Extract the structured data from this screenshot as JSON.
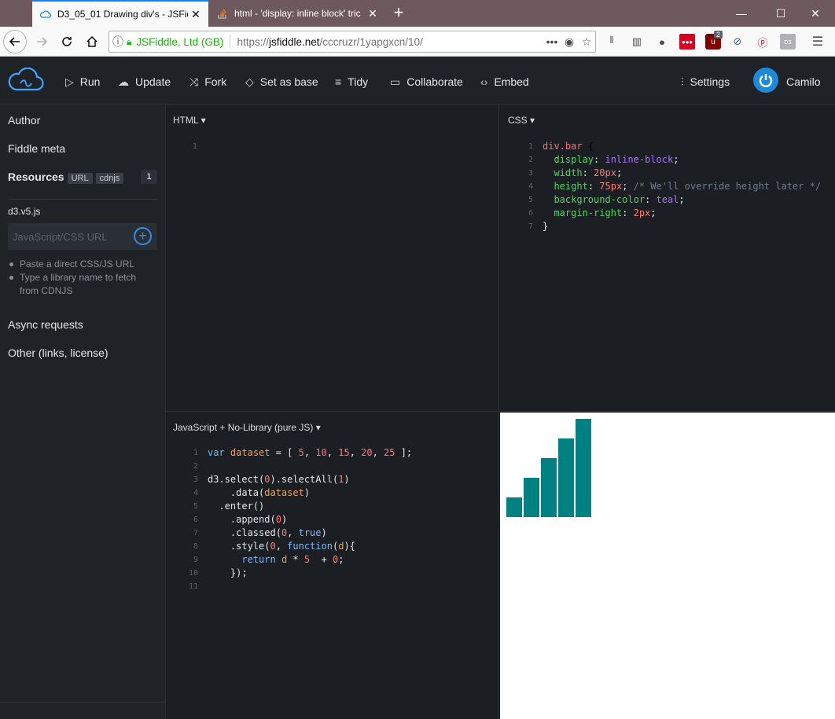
{
  "browser": {
    "tabs": [
      {
        "title": "D3_05_01 Drawing div's - JSFidd",
        "active": true
      },
      {
        "title": "html - 'display: inline block' tric",
        "active": false
      }
    ],
    "new_tab_label": "+",
    "site_identity": "JSFiddle, Ltd (GB)",
    "url_prefix": "https://",
    "url_domain": "jsfiddle.net",
    "url_path": "/cccruzr/1yapgxcn/10/",
    "badge_count": "2"
  },
  "toolbar": {
    "run": "Run",
    "update": "Update",
    "fork": "Fork",
    "set_as_base": "Set as base",
    "tidy": "Tidy",
    "collaborate": "Collaborate",
    "embed": "Embed",
    "settings": "Settings",
    "user": "Camilo"
  },
  "sidebar": {
    "author": "Author",
    "fiddle_meta": "Fiddle meta",
    "resources": "Resources",
    "chip_url": "URL",
    "chip_cdnjs": "cdnjs",
    "resource_count": "1",
    "resource_item": "d3.v5.js",
    "input_placeholder": "JavaScript/CSS URL",
    "hint1": "Paste a direct CSS/JS URL",
    "hint2_line1": "Type a library name to fetch",
    "hint2_line2": "from CDNJS",
    "async": "Async requests",
    "other": "Other (links, license)"
  },
  "panels": {
    "html_label": "HTML",
    "css_label": "CSS",
    "js_label": "JavaScript + No-Library (pure JS)"
  },
  "css_code": [
    "div.bar {",
    "  display: inline-block;",
    "  width: 20px;",
    "  height: 75px; /* We'll override height later */",
    "  background-color: teal;",
    "  margin-right: 2px;",
    "}"
  ],
  "js_code": [
    "var dataset = [ 5, 10, 15, 20, 25 ];",
    "",
    "d3.select(\"body\").selectAll(\"div\")",
    "    .data(dataset)",
    "  .enter()",
    "    .append(\"div\")",
    "    .classed(\"bar\", true)",
    "    .style(\"height\", function(d){",
    "      return d * 5  + \"px\";",
    "    });",
    ""
  ],
  "result": {
    "values": [
      5,
      10,
      15,
      20,
      25
    ],
    "multiplier": 5,
    "color": "#008080"
  }
}
